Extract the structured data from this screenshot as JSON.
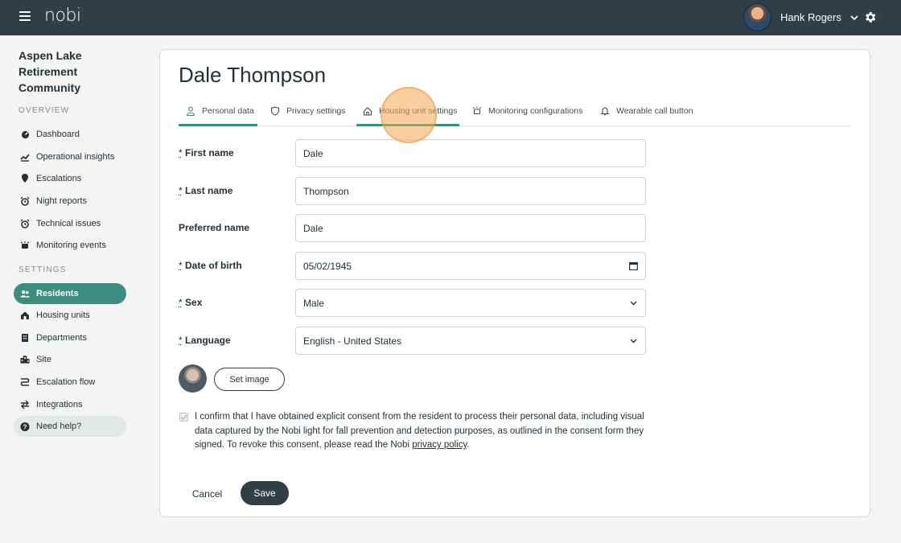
{
  "app": {
    "logo": "nobi"
  },
  "header": {
    "user_name": "Hank Rogers"
  },
  "sidebar": {
    "org_name": "Aspen Lake Retirement Community",
    "overview_heading": "OVERVIEW",
    "settings_heading": "SETTINGS",
    "overview_items": [
      {
        "label": "Dashboard",
        "icon": "dashboard-icon"
      },
      {
        "label": "Operational insights",
        "icon": "insights-icon"
      },
      {
        "label": "Escalations",
        "icon": "escalation-icon"
      },
      {
        "label": "Night reports",
        "icon": "alarm-clock-icon"
      },
      {
        "label": "Technical issues",
        "icon": "alarm-clock-icon"
      },
      {
        "label": "Monitoring events",
        "icon": "monitor-icon"
      }
    ],
    "settings_items": [
      {
        "label": "Residents",
        "icon": "users-icon",
        "active": true
      },
      {
        "label": "Housing units",
        "icon": "house-icon"
      },
      {
        "label": "Departments",
        "icon": "building-icon"
      },
      {
        "label": "Site",
        "icon": "site-icon"
      },
      {
        "label": "Escalation flow",
        "icon": "flow-icon"
      },
      {
        "label": "Integrations",
        "icon": "swap-icon"
      }
    ],
    "help_label": "Need help?"
  },
  "page": {
    "title": "Dale Thompson",
    "tabs": [
      {
        "label": "Personal data",
        "icon": "person-icon"
      },
      {
        "label": "Privacy settings",
        "icon": "shield-icon"
      },
      {
        "label": "Housing unit settings",
        "icon": "house-icon"
      },
      {
        "label": "Monitoring configurations",
        "icon": "monitor-icon"
      },
      {
        "label": "Wearable call button",
        "icon": "bell-icon"
      }
    ],
    "required_marker": "*",
    "fields": {
      "first_name": {
        "label": "First name",
        "value": "Dale"
      },
      "last_name": {
        "label": "Last name",
        "value": "Thompson"
      },
      "preferred_name": {
        "label": "Preferred name",
        "value": "Dale"
      },
      "dob": {
        "label": "Date of birth",
        "value": "05/02/1945"
      },
      "sex": {
        "label": "Sex",
        "value": "Male"
      },
      "language": {
        "label": "Language",
        "value": "English - United States"
      }
    },
    "set_image_label": "Set image",
    "consent_text": "I confirm that I have obtained explicit consent from the resident to process their personal data, including visual data captured by the Nobi light for fall prevention and detection purposes, as outlined in the consent form they signed. To revoke this consent, please read the Nobi ",
    "consent_link": "privacy policy",
    "consent_end": ".",
    "cancel_label": "Cancel",
    "save_label": "Save"
  },
  "colors": {
    "topbar": "#2f3f45",
    "accent": "#3c8c80",
    "click_indicator": "#f5a650"
  }
}
